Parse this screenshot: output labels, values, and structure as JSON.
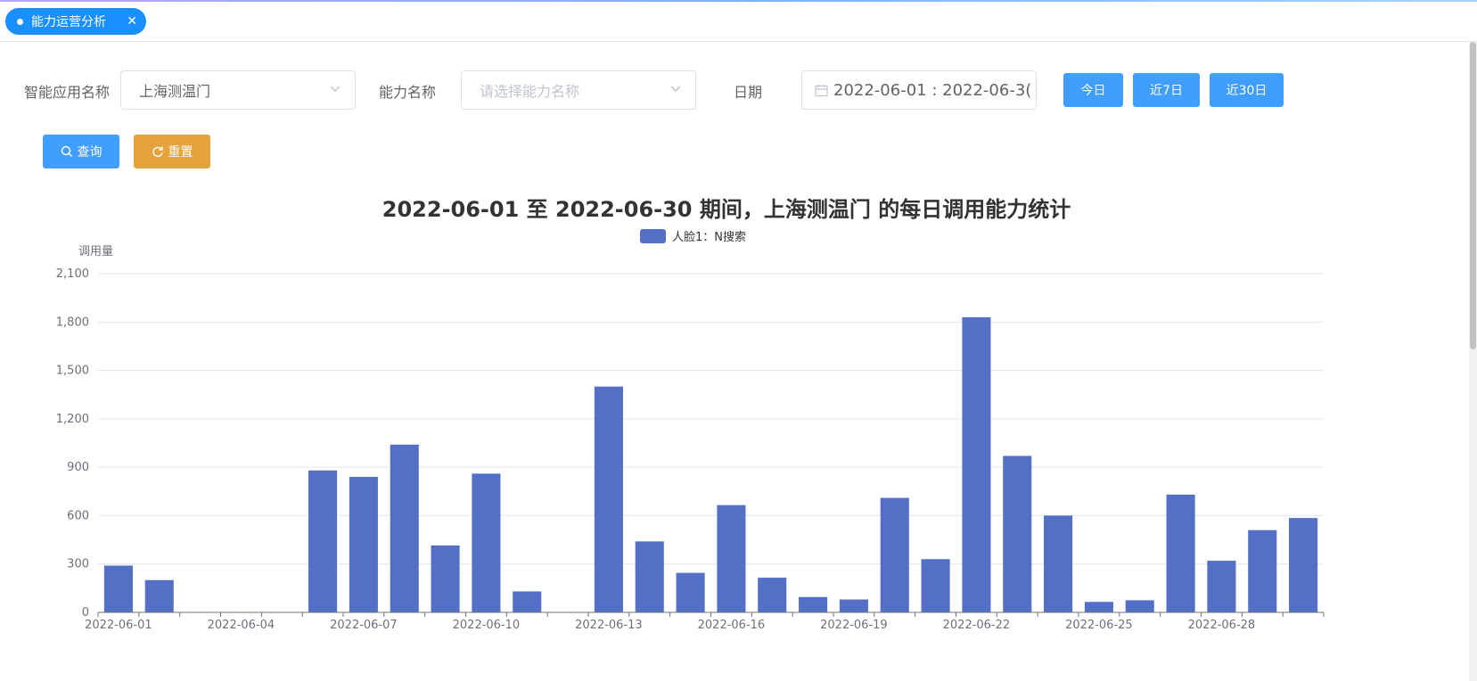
{
  "tabs": [
    {
      "label": "能力运营分析",
      "active": true
    }
  ],
  "filters": {
    "app_name_label": "智能应用名称",
    "app_name_value": "上海测温门",
    "ability_label": "能力名称",
    "ability_placeholder": "请选择能力名称",
    "date_label": "日期",
    "date_value": "2022-06-01 : 2022-06-3("
  },
  "buttons": {
    "today": "今日",
    "last7": "近7日",
    "last30": "近30日",
    "query": "查询",
    "reset": "重置"
  },
  "colors": {
    "primary": "#409eff",
    "tab": "#1890ff",
    "warning": "#e6a23c",
    "bar": "#5470c6"
  },
  "chart_data": {
    "type": "bar",
    "title": "2022-06-01 至 2022-06-30 期间，上海测温门 的每日调用能力统计",
    "ylabel": "调用量",
    "xlabel": "",
    "ylim": [
      0,
      2100
    ],
    "yticks": [
      0,
      300,
      600,
      900,
      1200,
      1500,
      1800,
      2100
    ],
    "ytick_labels": [
      "0",
      "300",
      "600",
      "900",
      "1,200",
      "1,500",
      "1,800",
      "2,100"
    ],
    "grid": true,
    "legend": "top-center",
    "categories": [
      "2022-06-01",
      "2022-06-02",
      "2022-06-03",
      "2022-06-04",
      "2022-06-05",
      "2022-06-06",
      "2022-06-07",
      "2022-06-08",
      "2022-06-09",
      "2022-06-10",
      "2022-06-11",
      "2022-06-12",
      "2022-06-13",
      "2022-06-14",
      "2022-06-15",
      "2022-06-16",
      "2022-06-17",
      "2022-06-18",
      "2022-06-19",
      "2022-06-20",
      "2022-06-21",
      "2022-06-22",
      "2022-06-23",
      "2022-06-24",
      "2022-06-25",
      "2022-06-26",
      "2022-06-27",
      "2022-06-28",
      "2022-06-29",
      "2022-06-30"
    ],
    "shown_x_labels": [
      "2022-06-01",
      "2022-06-04",
      "2022-06-07",
      "2022-06-10",
      "2022-06-13",
      "2022-06-16",
      "2022-06-19",
      "2022-06-22",
      "2022-06-25",
      "2022-06-28"
    ],
    "series": [
      {
        "name": "人脸1：N搜索",
        "values": [
          290,
          200,
          0,
          0,
          0,
          880,
          840,
          1040,
          415,
          860,
          130,
          0,
          1400,
          440,
          245,
          665,
          215,
          95,
          80,
          710,
          330,
          1830,
          970,
          600,
          65,
          75,
          730,
          320,
          510,
          585
        ]
      }
    ]
  }
}
